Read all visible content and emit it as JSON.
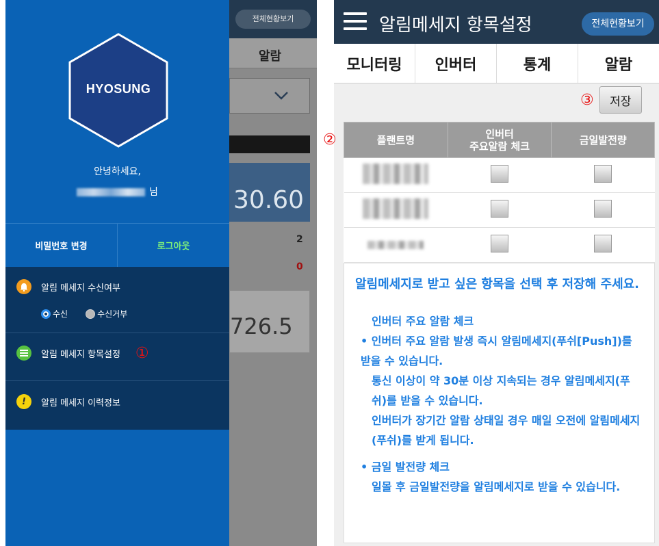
{
  "left": {
    "header_button": "전체현황보기",
    "tab_alarm": "알람",
    "value1": "30.60",
    "count2": "2",
    "count0": "0",
    "value2": "726.5",
    "logo": "HYOSUNG",
    "greeting": "안녕하세요,",
    "name_suffix": "님",
    "change_password": "비밀번호 변경",
    "logout": "로그아웃",
    "menu_receive": "알림 메세지 수신여부",
    "radio_receive": "수신",
    "radio_reject": "수신거부",
    "menu_settings": "알림 메세지 항목설정",
    "marker1": "①",
    "menu_history": "알림 메세지 이력정보",
    "colors": {
      "drawer": "#0a62b5",
      "menu": "#0b3560",
      "logout": "#7ff07a"
    }
  },
  "right": {
    "title": "알림메세지 항목설정",
    "overview_button": "전체현황보기",
    "tabs": [
      "모니터링",
      "인버터",
      "통계",
      "알람"
    ],
    "marker3": "③",
    "save": "저장",
    "marker2": "②",
    "columns": {
      "plant": "플랜트명",
      "inverter_line1": "인버터",
      "inverter_line2": "주요알람 체크",
      "daily": "금일발전량"
    },
    "intro": "알림메세지로 받고 싶은 항목을 선택 후 저장해 주세요.",
    "inverter_heading": "인버터 주요 알람 체크",
    "inverter_desc1": "• 인버터 주요 알람 발생 즉시 알림메세지(푸쉬[Push])를 받을 수 있습니다.",
    "inverter_desc2": "통신 이상이 약 30분 이상 지속되는 경우 알림메세지(푸쉬)를 받을 수 있습니다.",
    "inverter_desc3": "인버터가 장기간 알람 상태일 경우 매일 오전에 알림메세지(푸쉬)를 받게 됩니다.",
    "daily_heading": "• 금일 발전량 체크",
    "daily_desc": "일몰 후 금일발전량을 알림메세지로 받을 수 있습니다.",
    "accent": "#1f7fe0"
  }
}
